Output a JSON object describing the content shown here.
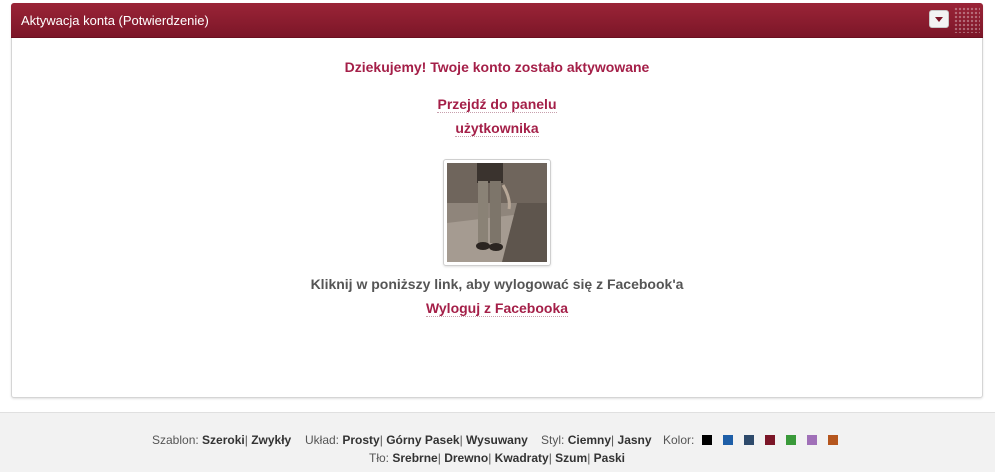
{
  "panel": {
    "title": "Aktywacja konta (Potwierdzenie)"
  },
  "content": {
    "thanks": "Dziekujemy! Twoje konto zostało aktywowane",
    "dashboard_link_line1": "Przejdź do panelu",
    "dashboard_link_line2": "użytkownika",
    "facebook_prompt": "Kliknij w poniższy link, aby wylogować się z Facebook'a",
    "facebook_logout": "Wyloguj z Facebooka"
  },
  "footer": {
    "template_label": "Szablon:",
    "template_options": [
      "Szeroki",
      "Zwykły"
    ],
    "layout_label": "Układ:",
    "layout_options": [
      "Prosty",
      "Górny Pasek",
      "Wysuwany"
    ],
    "style_label": "Styl:",
    "style_options": [
      "Ciemny",
      "Jasny"
    ],
    "color_label": "Kolor:",
    "colors": [
      "#000000",
      "#1e5fa8",
      "#2e4a6b",
      "#7c1628",
      "#3a9a3a",
      "#a070b8",
      "#b5561e"
    ],
    "background_label": "Tło:",
    "background_options": [
      "Srebrne",
      "Drewno",
      "Kwadraty",
      "Szum",
      "Paski"
    ],
    "separator": "|"
  },
  "accent_color": "#a41f48",
  "header_color": "#8a1d30"
}
